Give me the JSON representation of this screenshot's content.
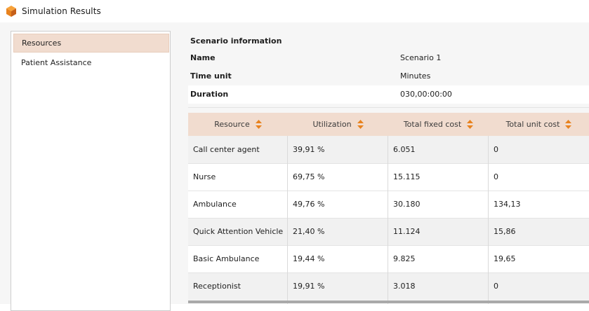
{
  "window": {
    "title": "Simulation Results",
    "icon": "cube-logo-icon"
  },
  "sidebar": {
    "items": [
      {
        "label": "Resources",
        "selected": true
      },
      {
        "label": "Patient Assistance",
        "selected": false
      }
    ]
  },
  "scenario": {
    "heading": "Scenario information",
    "rows": [
      {
        "label": "Name",
        "value": "Scenario 1"
      },
      {
        "label": "Time unit",
        "value": "Minutes"
      },
      {
        "label": "Duration",
        "value": "030,00:00:00"
      }
    ]
  },
  "table": {
    "columns": [
      "Resource",
      "Utilization",
      "Total fixed cost",
      "Total unit cost"
    ],
    "rows": [
      [
        "Call center agent",
        "39,91 %",
        "6.051",
        "0"
      ],
      [
        "Nurse",
        "69,75 %",
        "15.115",
        "0"
      ],
      [
        "Ambulance",
        "49,76 %",
        "30.180",
        "134,13"
      ],
      [
        "Quick Attention Vehicle",
        "21,40 %",
        "11.124",
        "15,86"
      ],
      [
        "Basic Ambulance",
        "19,44 %",
        "9.825",
        "19,65"
      ],
      [
        "Receptionist",
        "19,91 %",
        "3.018",
        "0"
      ]
    ]
  },
  "colors": {
    "accent": "#e8821e",
    "header_bg": "#f1dccf",
    "selected_bg": "#f1dccf"
  }
}
